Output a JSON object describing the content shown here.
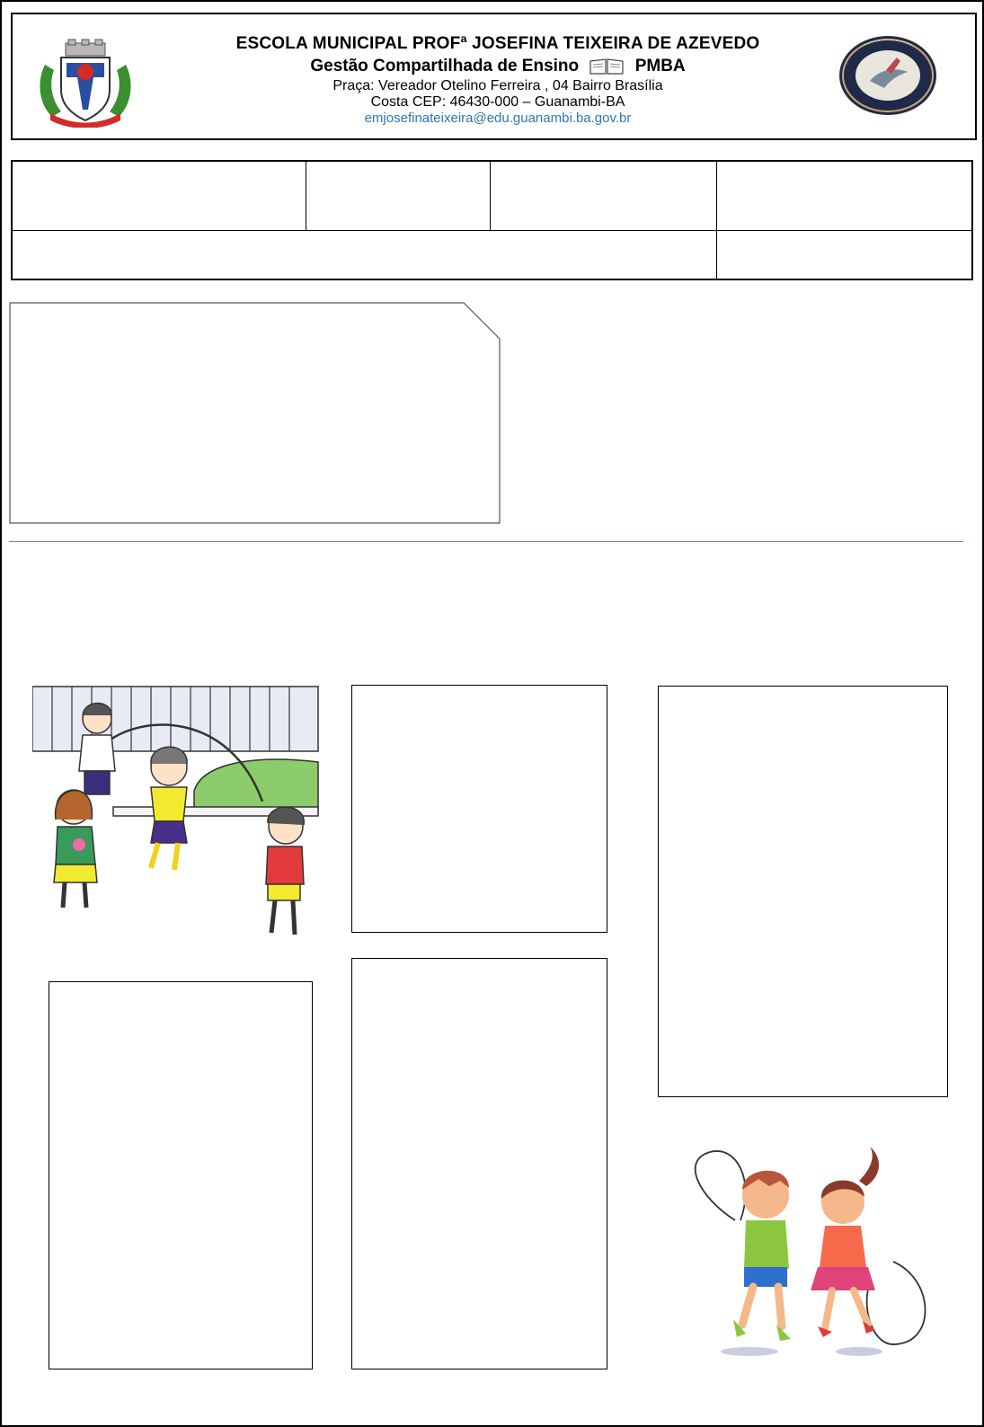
{
  "header": {
    "school_name": "ESCOLA MUNICIPAL  PROFª JOSEFINA TEIXEIRA DE AZEVEDO",
    "management_left": "Gestão Compartilhada de Ensino",
    "management_right": "PMBA",
    "address_line1": "Praça: Vereador Otelino Ferreira , 04 Bairro Brasília",
    "address_line2": "Costa CEP: 46430-000 – Guanambi-BA",
    "email": "emjosefinateixeira@edu.guanambi.ba.gov.br",
    "left_logo_icon": "municipal-coat-of-arms-icon",
    "right_logo_icon": "school-seal-icon",
    "book_icon": "open-book-icon",
    "email_color": "#2e75b6"
  },
  "form_table": {
    "row1": [
      "",
      "",
      "",
      ""
    ],
    "row2": [
      "",
      ""
    ]
  },
  "illustrations": {
    "top_left": "children-jumping-rope-illustration",
    "bottom_right": "boy-and-girl-skipping-rope-illustration"
  },
  "answer_frames": [
    "",
    "",
    "",
    ""
  ]
}
